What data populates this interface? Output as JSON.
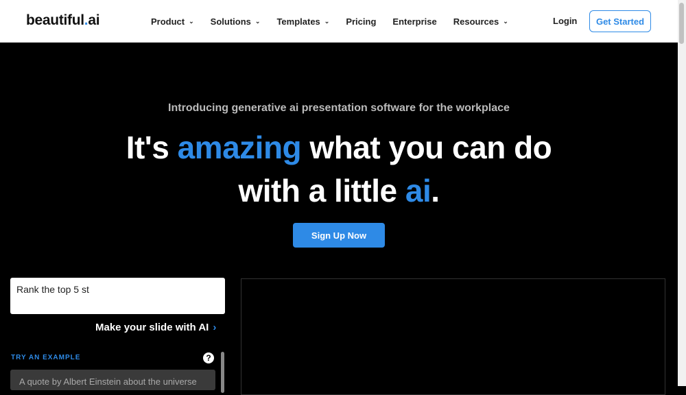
{
  "nav": {
    "logo_main": "beautiful",
    "logo_dot": ".",
    "logo_ai": "ai",
    "items": [
      {
        "label": "Product",
        "dropdown": true
      },
      {
        "label": "Solutions",
        "dropdown": true
      },
      {
        "label": "Templates",
        "dropdown": true
      },
      {
        "label": "Pricing",
        "dropdown": false
      },
      {
        "label": "Enterprise",
        "dropdown": false
      },
      {
        "label": "Resources",
        "dropdown": true
      }
    ],
    "login": "Login",
    "get_started": "Get Started"
  },
  "hero": {
    "intro": "Introducing generative ai presentation software for the workplace",
    "line1_a": "It's ",
    "line1_b": "amazing",
    "line1_c": " what you can do",
    "line2_a": "with a little ",
    "line2_b": "ai",
    "line2_c": ".",
    "cta": "Sign Up Now"
  },
  "generator": {
    "prompt_value": "Rank the top 5 st",
    "make_label": "Make your slide with AI",
    "try_label": "TRY AN EXAMPLE",
    "help": "?",
    "example": "A quote by Albert Einstein about the universe"
  },
  "colors": {
    "accent": "#2e8ae6",
    "background": "#000000"
  }
}
